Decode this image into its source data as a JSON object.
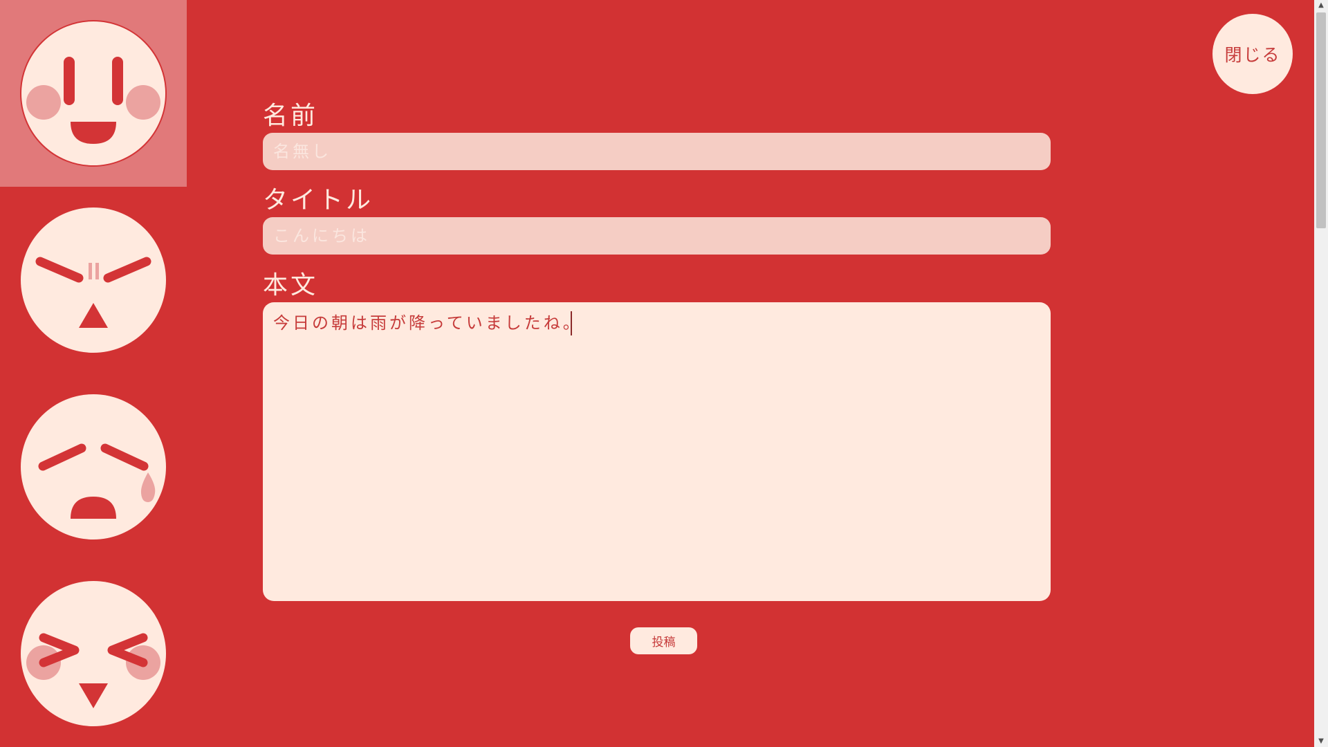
{
  "faces": [
    {
      "name": "happy-face-icon",
      "selected": true
    },
    {
      "name": "angry-face-icon",
      "selected": false
    },
    {
      "name": "crying-face-icon",
      "selected": false
    },
    {
      "name": "excited-face-icon",
      "selected": false
    }
  ],
  "form": {
    "name_label": "名前",
    "name_placeholder": "名無し",
    "name_value": "",
    "title_label": "タイトル",
    "title_placeholder": "こんにちは",
    "title_value": "",
    "body_label": "本文",
    "body_value": "今日の朝は雨が降っていましたね。"
  },
  "buttons": {
    "submit_label": "投稿",
    "close_label": "閉じる"
  },
  "colors": {
    "background": "#d23233",
    "cream": "#ffeadf",
    "input_fill": "#f5cdc4",
    "cheek": "#eba3a0",
    "feature": "#d33436"
  }
}
